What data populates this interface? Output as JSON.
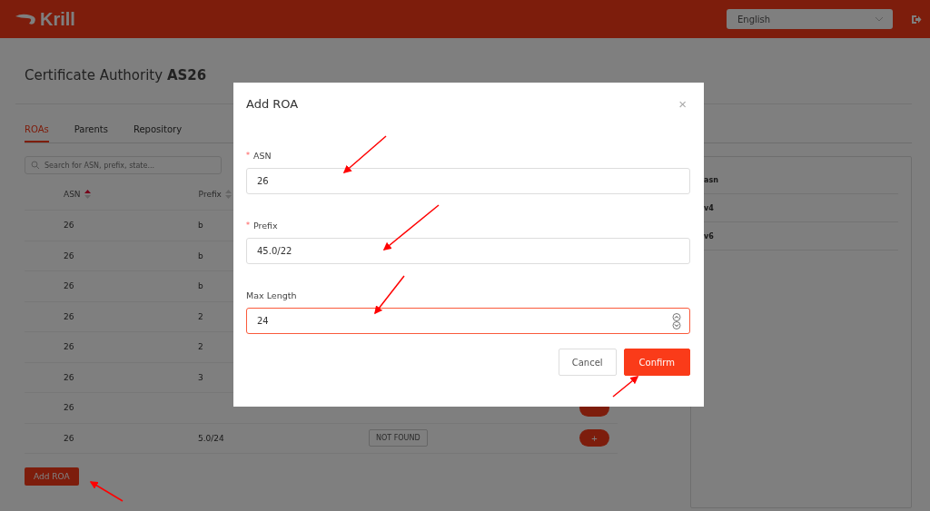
{
  "header": {
    "logo": "Krill",
    "language": "English"
  },
  "page": {
    "title_prefix": "Certificate Authority",
    "title_bold": "AS26"
  },
  "tabs": [
    {
      "label": "ROAs",
      "selected": true
    },
    {
      "label": "Parents",
      "selected": false
    },
    {
      "label": "Repository",
      "selected": false
    }
  ],
  "search": {
    "placeholder": "Search for ASN, prefix, state..."
  },
  "table": {
    "columns": [
      "ASN",
      "Prefix"
    ],
    "rows": [
      {
        "asn": "26",
        "prefix": "b"
      },
      {
        "asn": "26",
        "prefix": "b"
      },
      {
        "asn": "26",
        "prefix": "b"
      },
      {
        "asn": "26",
        "prefix": "2"
      },
      {
        "asn": "26",
        "prefix": "2"
      },
      {
        "asn": "26",
        "prefix": "3"
      },
      {
        "asn": "26",
        "plus_button": true
      },
      {
        "asn": "26",
        "prefix": "5.0/24",
        "status": "NOT FOUND",
        "action": "+"
      }
    ]
  },
  "add_button": "Add ROA",
  "info": {
    "rows": [
      "asn",
      "v4",
      "v6"
    ]
  },
  "dialog": {
    "title": "Add ROA",
    "close": "×",
    "fields": [
      {
        "label": "ASN",
        "required": true,
        "required_mark": "*",
        "value": "26",
        "focused": false,
        "kind": "text"
      },
      {
        "label": "Prefix",
        "required": true,
        "required_mark": "*",
        "value": "45.0/22",
        "focused": false,
        "kind": "text"
      },
      {
        "label": "Max Length",
        "required": false,
        "value": "24",
        "focused": true,
        "kind": "number"
      }
    ],
    "buttons": [
      {
        "label": "Cancel",
        "primary": false
      },
      {
        "label": "Confirm",
        "primary": true
      }
    ]
  }
}
